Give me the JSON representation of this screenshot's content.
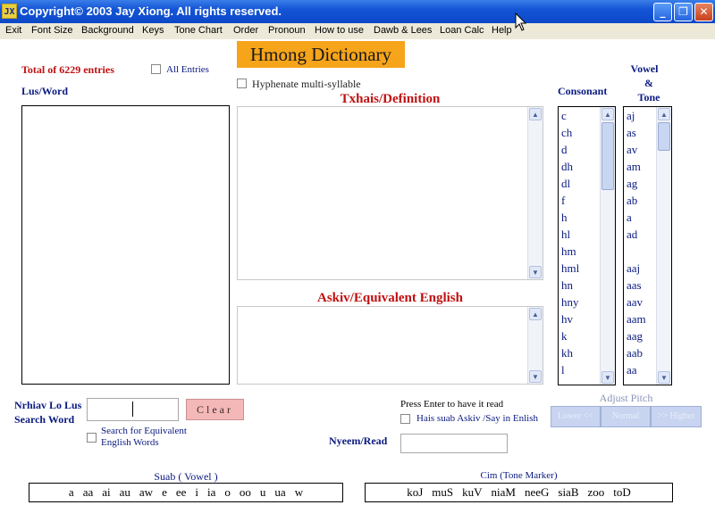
{
  "window": {
    "icon_text": "JX",
    "title": "Copyright© 2003 Jay Xiong. All rights reserved."
  },
  "menu": [
    "Exit",
    "Font Size",
    "Background",
    "Keys",
    "Tone Chart",
    "Order",
    "Pronoun",
    "How to use",
    "Dawb & Lees",
    "Loan Calc",
    "Help"
  ],
  "header": {
    "app_title": "Hmong Dictionary",
    "total_entries": "Total of 6229 entries",
    "all_entries": "All Entries",
    "hyphenate": "Hyphenate multi-syllable",
    "lus_word": "Lus/Word",
    "definition_label": "Txhais/Definition",
    "equivalent_label": "Askiv/Equivalent English",
    "consonant_label": "Consonant",
    "vowel_label": "Vowel",
    "amp": "&",
    "tone_label": "Tone"
  },
  "consonants": [
    "c",
    "ch",
    "d",
    "dh",
    "dl",
    "f",
    "h",
    "hl",
    "hm",
    "hml",
    "hn",
    "hny",
    "hv",
    "k",
    "kh",
    "l"
  ],
  "vowels": [
    "aj",
    "as",
    "av",
    "am",
    "ag",
    "ab",
    "a",
    "ad",
    "",
    "aaj",
    "aas",
    "aav",
    "aam",
    "aag",
    "aab",
    "aa"
  ],
  "search": {
    "label_1": "Nrhiav Lo Lus",
    "label_2": "Search Word",
    "input_value": "",
    "clear_label": "Clear",
    "equiv_label_1": "Search for Equivalent",
    "equiv_label_2": "English Words"
  },
  "read": {
    "press_enter": "Press Enter to have it read",
    "say_english": "Hais suab Askiv /Say in Enlish",
    "nyeem_label": "Nyeem/Read",
    "input_value": ""
  },
  "pitch": {
    "label": "Adjust Pitch",
    "lower": "Lower <<",
    "normal": "Normal",
    "higher": ">> Higher"
  },
  "suab": {
    "label": "Suab ( Vowel )",
    "keys": [
      "a",
      "aa",
      "ai",
      "au",
      "aw",
      "e",
      "ee",
      "i",
      "ia",
      "o",
      "oo",
      "u",
      "ua",
      "w"
    ]
  },
  "cim": {
    "label": "Cim (Tone Marker)",
    "keys": [
      "koJ",
      "muS",
      "kuV",
      "niaM",
      "neeG",
      "siaB",
      "zoo",
      "toD"
    ]
  },
  "colors": {
    "title_bar": "#0c48c8",
    "menu_bg": "#ece9d8",
    "accent_orange": "#f6a41a",
    "label_navy": "#0a1a80",
    "label_red": "#c01010"
  }
}
